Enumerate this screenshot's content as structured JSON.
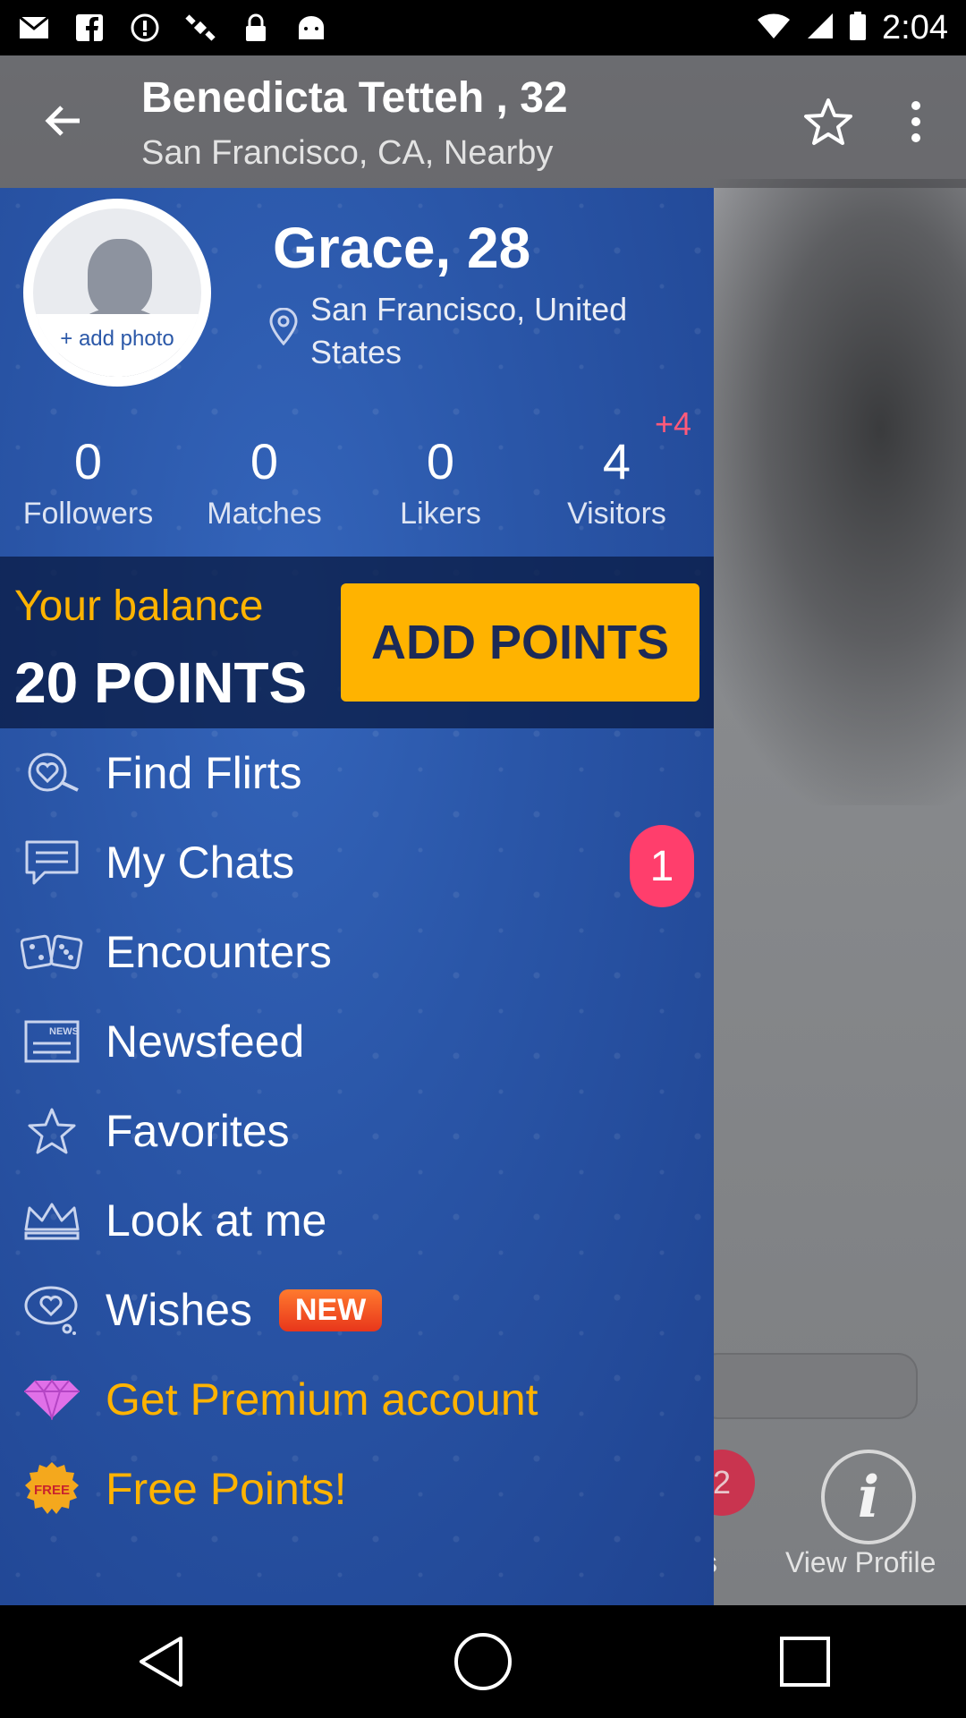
{
  "status_bar": {
    "icons": [
      "mail-icon",
      "facebook-icon",
      "info-icon",
      "satellite-icon",
      "lock-icon",
      "android-icon"
    ],
    "time": "2:04"
  },
  "background": {
    "title": "Benedicta Tetteh , 32",
    "subtitle": "San Francisco, CA, Nearby",
    "badge_count": "2",
    "tab_partial": "s",
    "view_profile_label": "View Profile"
  },
  "drawer": {
    "profile": {
      "add_photo_label": "+ add photo",
      "name": "Grace, 28",
      "location": "San Francisco, United States"
    },
    "stats": {
      "visitors_delta": "+4",
      "items": [
        {
          "value": "0",
          "label": "Followers"
        },
        {
          "value": "0",
          "label": "Matches"
        },
        {
          "value": "0",
          "label": "Likers"
        },
        {
          "value": "4",
          "label": "Visitors"
        }
      ]
    },
    "balance": {
      "label": "Your balance",
      "value": "20 POINTS",
      "add_points_label": "ADD POINTS"
    },
    "menu": {
      "find_flirts": "Find Flirts",
      "my_chats": "My Chats",
      "my_chats_badge": "1",
      "encounters": "Encounters",
      "newsfeed": "Newsfeed",
      "newsfeed_icon_text": "NEWS",
      "favorites": "Favorites",
      "look_at_me": "Look at me",
      "wishes": "Wishes",
      "wishes_badge": "NEW",
      "premium": "Get Premium account",
      "free_points": "Free Points!",
      "free_icon_text": "FREE"
    }
  },
  "colors": {
    "drawer_blue": "#2a56a8",
    "accent_gold": "#ffb300",
    "badge_pink": "#ff3e6c"
  }
}
